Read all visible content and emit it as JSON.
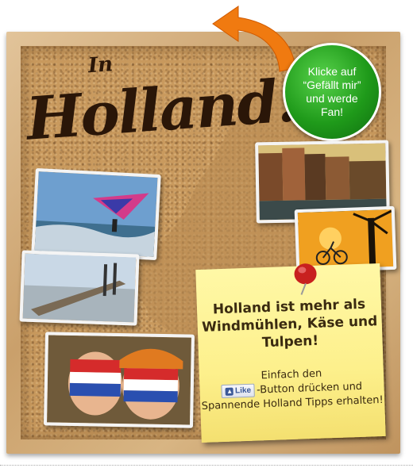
{
  "title": {
    "prefix": "In",
    "name": "Holland."
  },
  "fan_badge": {
    "text": "Klicke auf\n“Gefällt mir”\nund werde\nFan!",
    "color": "#1f9a1a"
  },
  "note": {
    "headline": "Holland ist mehr als Windmühlen, Käse und Tulpen!",
    "body_before": "Einfach den",
    "like_button_label": "Like",
    "body_after": "-Button drücken und Spannende Holland Tipps erhalten!"
  },
  "icons": {
    "arrow": "curved-arrow-icon",
    "pin": "pushpin-icon",
    "like_thumb": "thumbs-up-icon"
  },
  "colors": {
    "cork": "#c99a5e",
    "frame": "#d2ac78",
    "arrow": "#f07a10",
    "note": "#fdf08c",
    "like_text": "#3b5998"
  }
}
